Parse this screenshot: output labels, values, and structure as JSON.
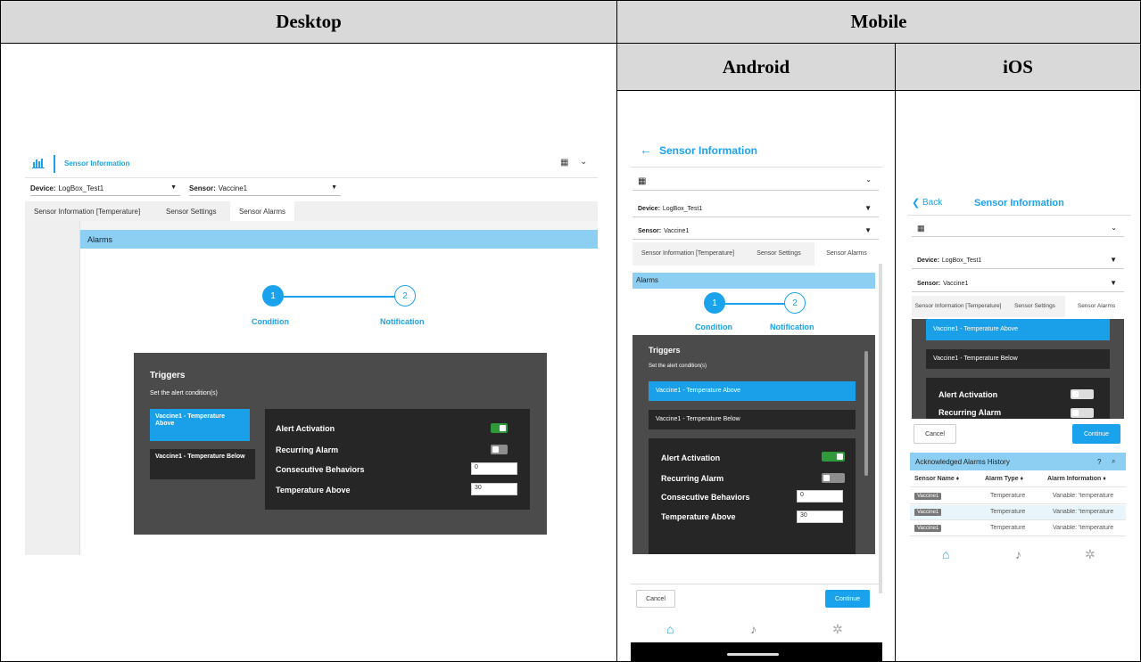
{
  "table": {
    "desktop": "Desktop",
    "mobile": "Mobile",
    "android": "Android",
    "ios": "iOS"
  },
  "desktop": {
    "title": "Sensor Information",
    "device_label": "Device:",
    "device_value": "LogBox_Test1",
    "sensor_label": "Sensor:",
    "sensor_value": "Vaccine1",
    "tabs": [
      "Sensor Information [Temperature]",
      "Sensor Settings",
      "Sensor Alarms"
    ],
    "alarms_header": "Alarms",
    "steps": [
      {
        "num": "1",
        "label": "Condition"
      },
      {
        "num": "2",
        "label": "Notification"
      }
    ],
    "triggers_title": "Triggers",
    "triggers_subtitle": "Set the alert condition(s)",
    "trigger_items": [
      "Vaccine1 - Temperature Above",
      "Vaccine1 - Temperature Below"
    ],
    "settings": {
      "alert_activation": "Alert Activation",
      "recurring_alarm": "Recurring Alarm",
      "consecutive_behaviors": "Consecutive Behaviors",
      "consecutive_value": "0",
      "temperature_above": "Temperature Above",
      "temperature_value": "30"
    }
  },
  "android": {
    "title": "Sensor Information",
    "device_label": "Device:",
    "device_value": "LogBox_Test1",
    "sensor_label": "Sensor:",
    "sensor_value": "Vaccine1",
    "tabs": [
      "Sensor Information [Temperature]",
      "Sensor Settings",
      "Sensor Alarms"
    ],
    "alarms_header": "Alarms",
    "steps": [
      {
        "num": "1",
        "label": "Condition"
      },
      {
        "num": "2",
        "label": "Notification"
      }
    ],
    "triggers_title": "Triggers",
    "triggers_subtitle": "Set the alert condition(s)",
    "trigger_items": [
      "Vaccine1 - Temperature Above",
      "Vaccine1 - Temperature Below"
    ],
    "settings": {
      "alert_activation": "Alert Activation",
      "recurring_alarm": "Recurring Alarm",
      "consecutive_behaviors": "Consecutive Behaviors",
      "consecutive_value": "0",
      "temperature_above": "Temperature Above",
      "temperature_value": "30"
    },
    "cancel": "Cancel",
    "continue": "Continue"
  },
  "ios": {
    "back": "Back",
    "title": "Sensor Information",
    "device_label": "Device:",
    "device_value": "LogBox_Test1",
    "sensor_label": "Sensor:",
    "sensor_value": "Vaccine1",
    "tabs": [
      "Sensor Information [Temperature]",
      "Sensor Settings",
      "Sensor Alarms"
    ],
    "trigger_items": [
      "Vaccine1 - Temperature Above",
      "Vaccine1 - Temperature Below"
    ],
    "alert_activation": "Alert Activation",
    "recurring_alarm": "Recurring Alarm",
    "cancel": "Cancel",
    "continue": "Continue",
    "history": {
      "title": "Acknowledged Alarms History",
      "help": "?",
      "columns": [
        "Sensor Name ♦",
        "Alarm Type ♦",
        "Alarm Information ♦"
      ],
      "rows": [
        {
          "sensor": "Vaccine1",
          "type": "Temperature",
          "info": "Variable: 'temperature"
        },
        {
          "sensor": "Vaccine1",
          "type": "Temperature",
          "info": "Variable: 'temperature"
        },
        {
          "sensor": "Vaccine1",
          "type": "Temperature",
          "info": "Variable: 'temperature"
        }
      ]
    }
  },
  "colors": {
    "accent": "#1aa3ec",
    "toggle_on": "#2f9a3a",
    "panel_dark": "#4b4b4b",
    "alarms_header": "#8dcff2"
  },
  "icons": [
    "chart-icon",
    "calendar-icon",
    "chevron-down-icon",
    "back-arrow-icon",
    "home-icon",
    "bell-icon",
    "gear-icon",
    "search-icon"
  ]
}
